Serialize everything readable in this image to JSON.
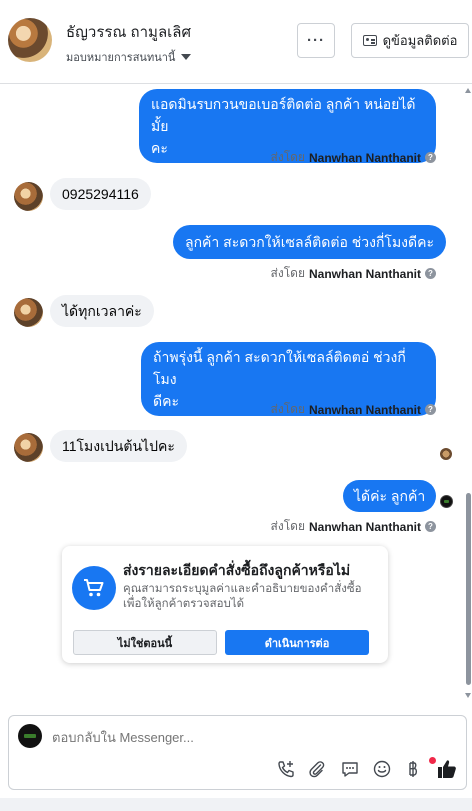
{
  "header": {
    "contact_name": "ธัญวรรณ ถามูลเลิศ",
    "assign_label": "มอบหมายการสนทนานี้",
    "more_label": "···",
    "contact_info_label": "ดูข้อมูลติดต่อ"
  },
  "messages": [
    {
      "direction": "out",
      "text": "แอดมินรบกวนขอเบอร์ติดต่อ ลูกค้า หน่อยได้มั้ยคะ",
      "line1": "แอดมินรบกวนขอเบอร์ติดต่อ ลูกค้า หน่อยได้มั้ย",
      "line2": "คะ"
    },
    {
      "direction": "in",
      "text": "0925294116"
    },
    {
      "direction": "out",
      "text": "ลูกค้า สะดวกให้เซลล์ติดต่อ ช่วงกี่โมงดีคะ"
    },
    {
      "direction": "in",
      "text": "ได้ทุกเวลาค่ะ"
    },
    {
      "direction": "out",
      "text": "ถ้าพรุ่งนี้ ลูกค้า  สะดวกให้เซลล์ติดตอ่ ช่วงกี่โมงดีคะ",
      "line1": "ถ้าพรุ่งนี้ ลูกค้า  สะดวกให้เซลล์ติดตอ่ ช่วงกี่โมง",
      "line2": "ดีคะ"
    },
    {
      "direction": "in",
      "text": "11โมงเปนต้นไปคะ"
    },
    {
      "direction": "out",
      "text": "ได้ค่ะ  ลูกค้า"
    }
  ],
  "sent_by": {
    "prefix": "ส่งโดย",
    "name": "Nanwhan Nanthanit",
    "help": "?"
  },
  "order_card": {
    "title": "ส่งรายละเอียดคำสั่งซื้อถึงลูกค้าหรือไม่",
    "description": "คุณสามารถระบุมูลค่าและคำอธิบายของคำสั่งซื้อเพื่อให้ลูกค้าตรวจสอบได้",
    "not_now_label": "ไม่ใช่ตอนนี้",
    "continue_label": "ดำเนินการต่อ"
  },
  "composer": {
    "placeholder": "ตอบกลับใน Messenger..."
  },
  "colors": {
    "accent": "#1877f2",
    "incoming_bubble": "#f0f2f5",
    "notification_dot": "#f02849"
  },
  "icons": [
    "chevron-down-icon",
    "contact-card-icon",
    "cart-icon",
    "help-icon",
    "add-call-icon",
    "attachment-icon",
    "saved-reply-icon",
    "emoji-icon",
    "currency-icon",
    "thumbs-up-icon"
  ]
}
